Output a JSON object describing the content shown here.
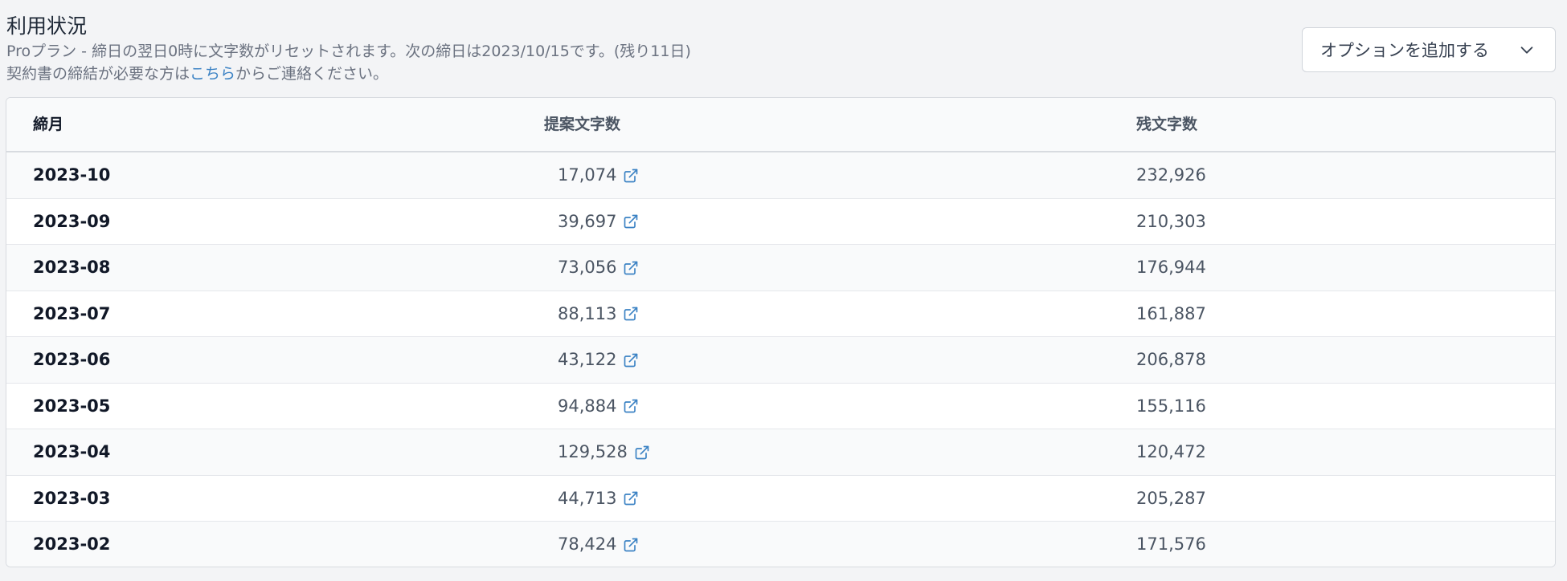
{
  "header": {
    "title": "利用状況",
    "plan_line": "Proプラン - 締日の翌日0時に文字数がリセットされます。次の締日は2023/10/15です。(残り11日)",
    "contract_prefix": "契約書の締結が必要な方は",
    "contract_link": "こちら",
    "contract_suffix": "からご連絡ください。"
  },
  "option_button": {
    "label": "オプションを追加する",
    "icon": "chevron-down-icon"
  },
  "table": {
    "columns": [
      "締月",
      "提案文字数",
      "残文字数"
    ],
    "rows": [
      {
        "month": "2023-10",
        "proposed": "17,074",
        "remaining": "232,926"
      },
      {
        "month": "2023-09",
        "proposed": "39,697",
        "remaining": "210,303"
      },
      {
        "month": "2023-08",
        "proposed": "73,056",
        "remaining": "176,944"
      },
      {
        "month": "2023-07",
        "proposed": "88,113",
        "remaining": "161,887"
      },
      {
        "month": "2023-06",
        "proposed": "43,122",
        "remaining": "206,878"
      },
      {
        "month": "2023-05",
        "proposed": "94,884",
        "remaining": "155,116"
      },
      {
        "month": "2023-04",
        "proposed": "129,528",
        "remaining": "120,472"
      },
      {
        "month": "2023-03",
        "proposed": "44,713",
        "remaining": "205,287"
      },
      {
        "month": "2023-02",
        "proposed": "78,424",
        "remaining": "171,576"
      }
    ],
    "link_icon": "external-link-icon"
  },
  "colors": {
    "link": "#3b82c4",
    "row_alt": "#f9fafb",
    "border": "#d8dbe0"
  }
}
